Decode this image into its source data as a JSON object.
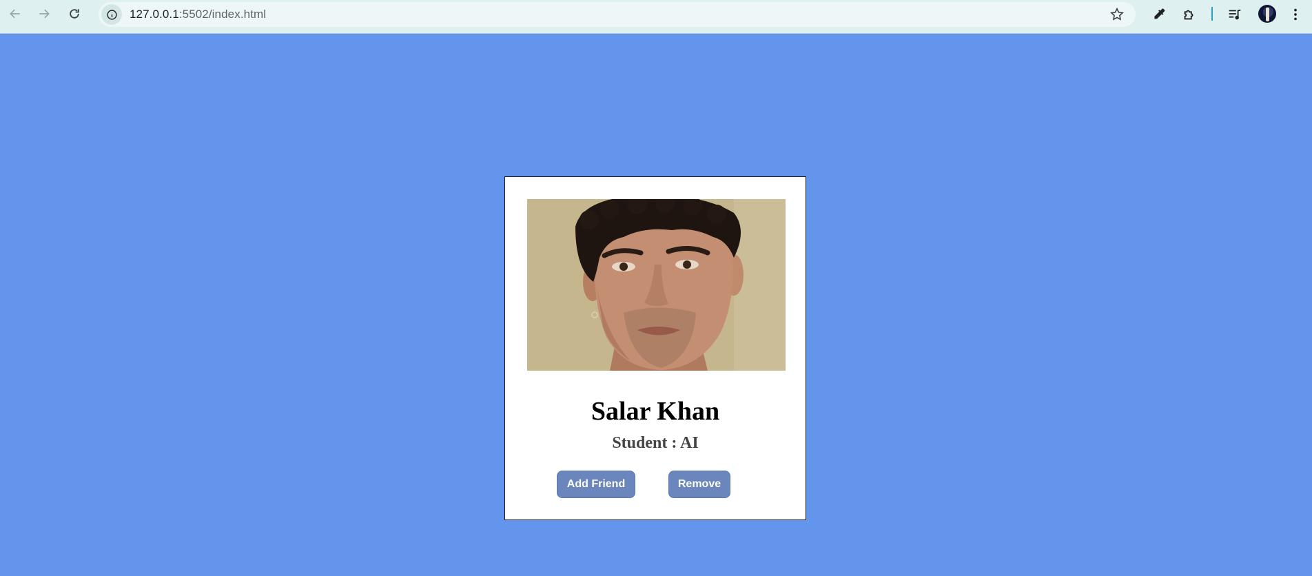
{
  "browser": {
    "url_host": "127.0.0.1",
    "url_path": ":5502/index.html"
  },
  "card": {
    "photo_alt": "profile photo",
    "name": "Salar Khan",
    "role": "Student : AI",
    "add_button": "Add Friend",
    "remove_button": "Remove"
  },
  "colors": {
    "page_background": "#6495ed",
    "button_background": "#6a86bd",
    "card_background": "#ffffff"
  },
  "icons": [
    "back-icon",
    "forward-icon",
    "reload-icon",
    "site-info-icon",
    "bookmark-star-icon",
    "eyedropper-icon",
    "extensions-icon",
    "media-queue-icon",
    "profile-avatar",
    "menu-icon"
  ]
}
